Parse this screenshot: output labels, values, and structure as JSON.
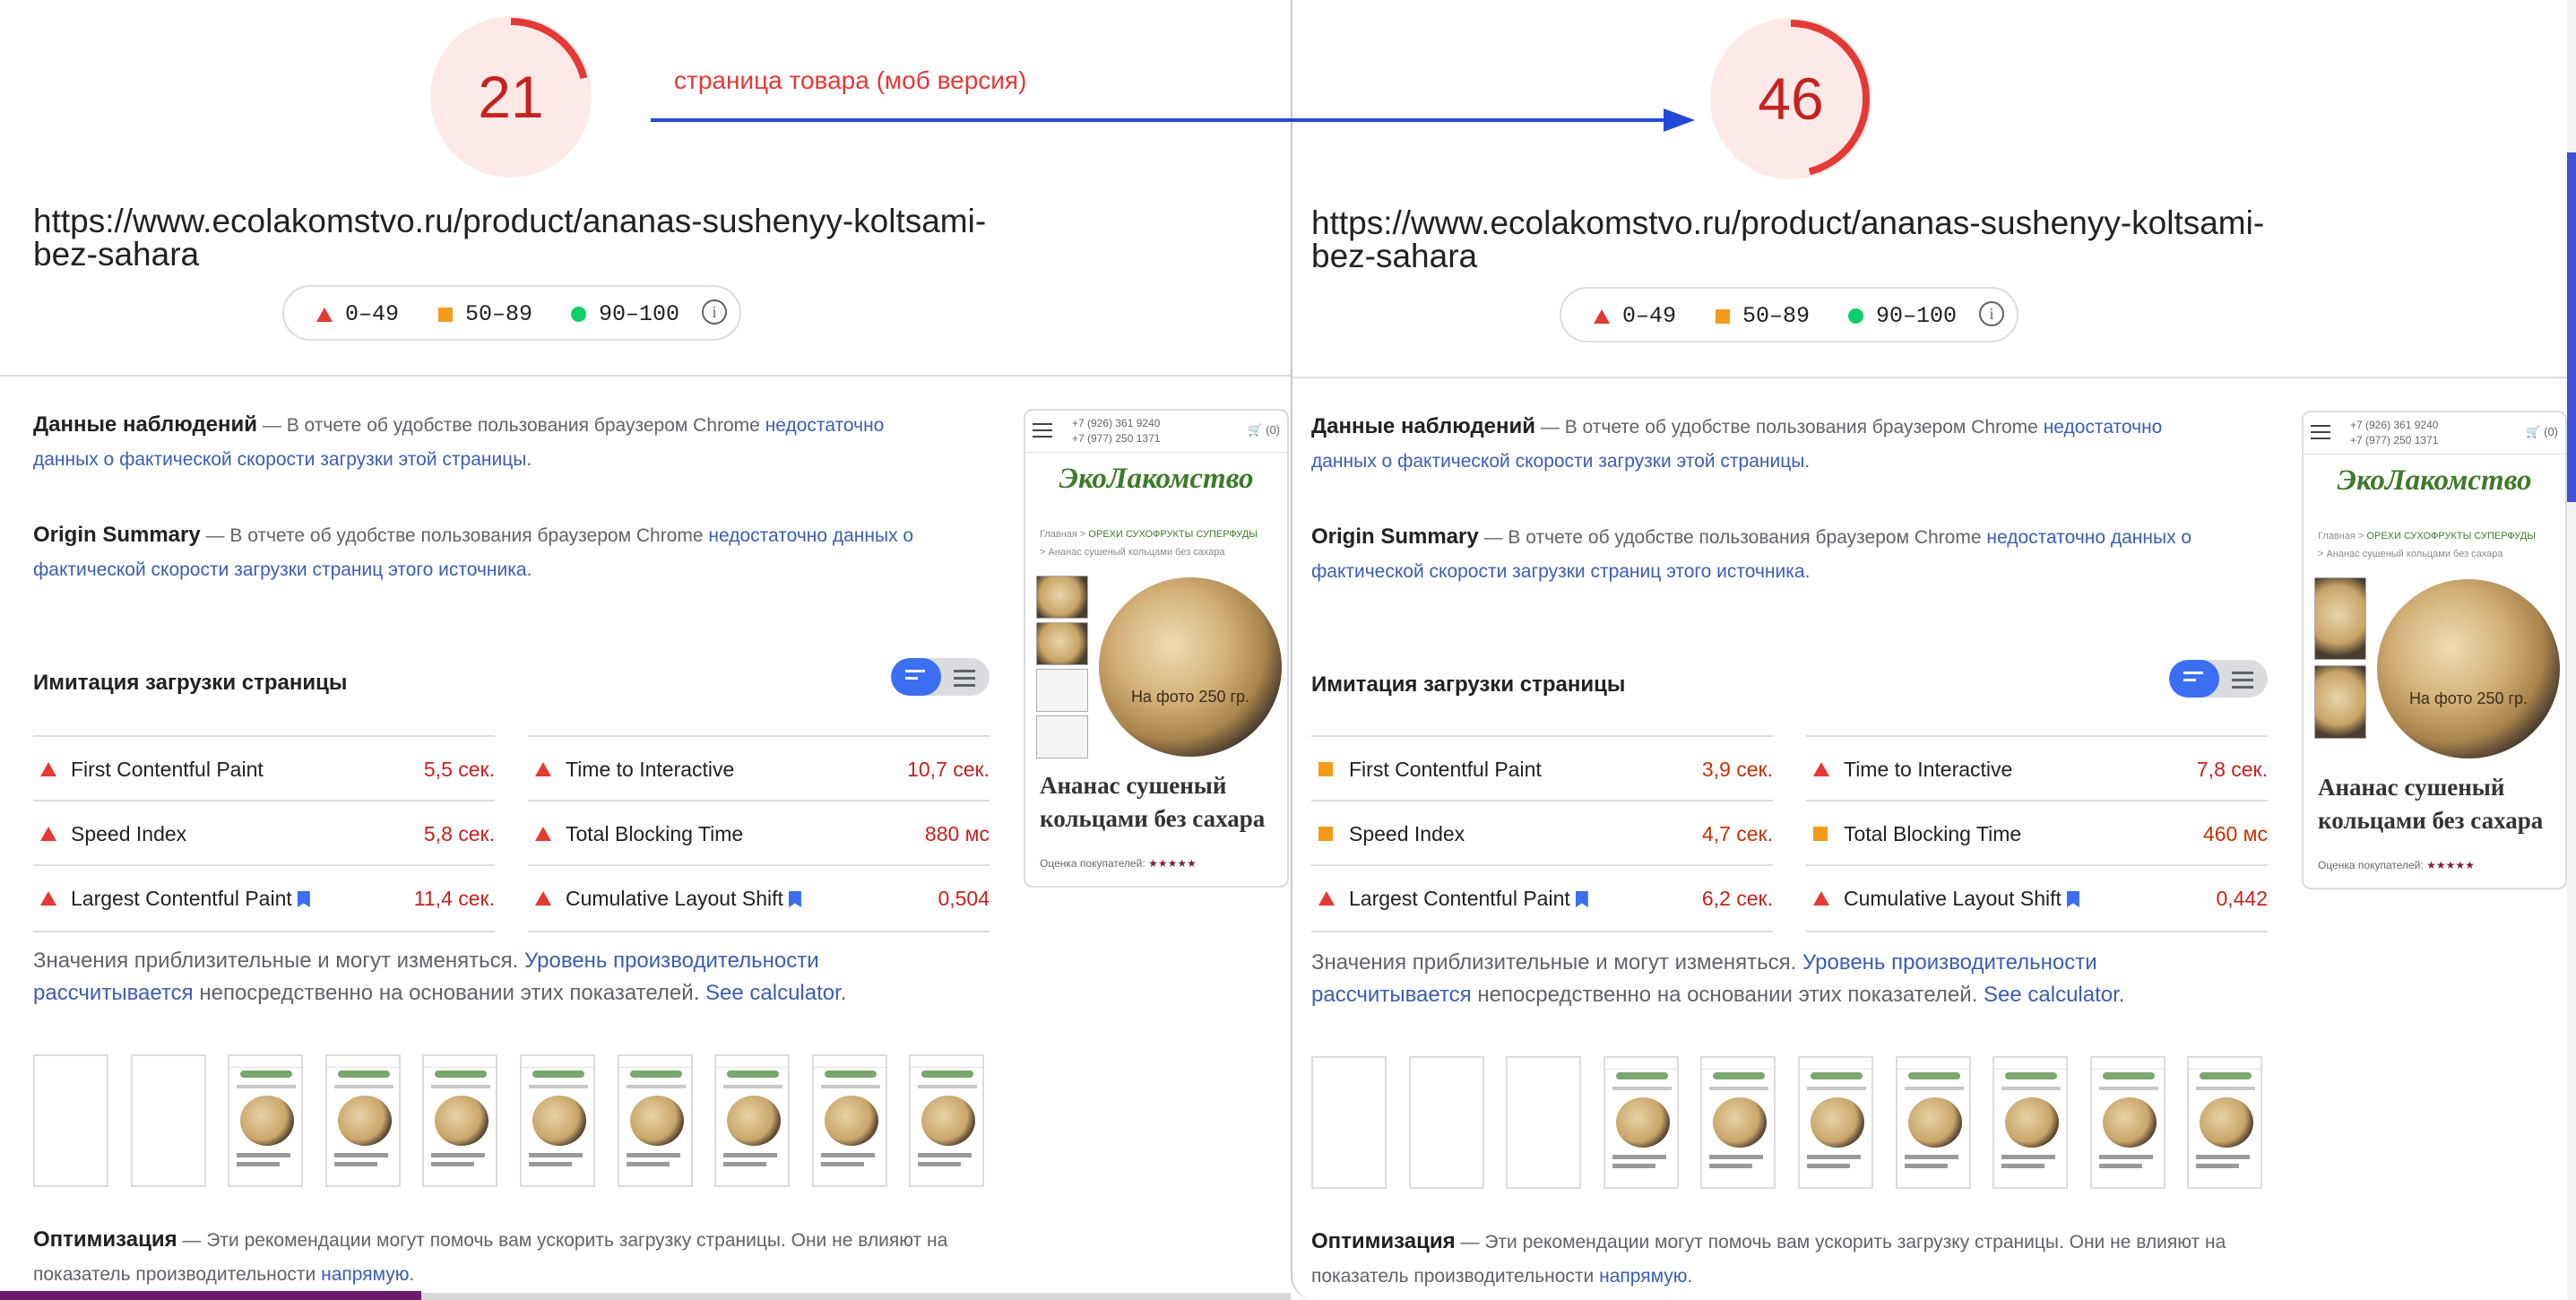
{
  "annotation": "страница товара (моб версия)",
  "colors": {
    "fail": "#e53935",
    "average": "#f49b1a",
    "pass": "#0cce6b",
    "link": "#3c5db1",
    "arrow": "#2448d9"
  },
  "left": {
    "score": "21",
    "score_fraction": 0.21,
    "url_line1": "https://www.ecolakomstvo.ru/product/ananas-sushenyy-koltsami-",
    "url_line2": "bez-sahara",
    "legend": {
      "fail": "0–49",
      "average": "50–89",
      "pass": "90–100"
    },
    "field_data": {
      "title": "Данные наблюдений",
      "dash": " — В отчете об удобстве пользования браузером Chrome ",
      "link": "недостаточно данных о фактической скорости загрузки этой страницы",
      "end": "."
    },
    "origin": {
      "title": "Origin Summary",
      "dash": " — В отчете об удобстве пользования браузером Chrome ",
      "link": "недостаточно данных о фактической скорости загрузки страниц этого источника",
      "end": "."
    },
    "lab_title": "Имитация загрузки страницы",
    "metrics": [
      {
        "name": "First Contentful Paint",
        "value": "5,5 сек.",
        "status": "fail",
        "bookmark": false
      },
      {
        "name": "Time to Interactive",
        "value": "10,7 сек.",
        "status": "fail",
        "bookmark": false
      },
      {
        "name": "Speed Index",
        "value": "5,8 сек.",
        "status": "fail",
        "bookmark": false
      },
      {
        "name": "Total Blocking Time",
        "value": "880 мс",
        "status": "fail",
        "bookmark": false
      },
      {
        "name": "Largest Contentful Paint",
        "value": "11,4 сек.",
        "status": "fail",
        "bookmark": true
      },
      {
        "name": "Cumulative Layout Shift",
        "value": "0,504",
        "status": "fail",
        "bookmark": true
      }
    ],
    "note": {
      "text1": "Значения приблизительные и могут изменяться. ",
      "link1": "Уровень производительности рассчитывается",
      "text2": " непосредственно на основании этих показателей. ",
      "link2": "See calculator",
      "end": "."
    },
    "filmstrip_blank": 2,
    "opt": {
      "title": "Оптимизация",
      "text": " — Эти рекомендации могут помочь вам ускорить загрузку страницы. Они не влияют на показатель производительности ",
      "link": "напрямую",
      "end": "."
    }
  },
  "right": {
    "score": "46",
    "score_fraction": 0.46,
    "url_line1": "https://www.ecolakomstvo.ru/product/ananas-sushenyy-koltsami-",
    "url_line2": "bez-sahara",
    "legend": {
      "fail": "0–49",
      "average": "50–89",
      "pass": "90–100"
    },
    "field_data": {
      "title": "Данные наблюдений",
      "dash": " — В отчете об удобстве пользования браузером Chrome ",
      "link": "недостаточно данных о фактической скорости загрузки этой страницы",
      "end": "."
    },
    "origin": {
      "title": "Origin Summary",
      "dash": " — В отчете об удобстве пользования браузером Chrome ",
      "link": "недостаточно данных о фактической скорости загрузки страниц этого источника",
      "end": "."
    },
    "lab_title": "Имитация загрузки страницы",
    "metrics": [
      {
        "name": "First Contentful Paint",
        "value": "3,9 сек.",
        "status": "average",
        "bookmark": false
      },
      {
        "name": "Time to Interactive",
        "value": "7,8 сек.",
        "status": "fail",
        "bookmark": false
      },
      {
        "name": "Speed Index",
        "value": "4,7 сек.",
        "status": "average",
        "bookmark": false
      },
      {
        "name": "Total Blocking Time",
        "value": "460 мс",
        "status": "average",
        "bookmark": false
      },
      {
        "name": "Largest Contentful Paint",
        "value": "6,2 сек.",
        "status": "fail",
        "bookmark": true
      },
      {
        "name": "Cumulative Layout Shift",
        "value": "0,442",
        "status": "fail",
        "bookmark": true
      }
    ],
    "note": {
      "text1": "Значения приблизительные и могут изменяться. ",
      "link1": "Уровень производительности рассчитывается",
      "text2": " непосредственно на основании этих показателей. ",
      "link2": "See calculator",
      "end": "."
    },
    "filmstrip_blank": 3,
    "opt": {
      "title": "Оптимизация",
      "text": " — Эти рекомендации могут помочь вам ускорить загрузку страницы. Они не влияют на показатель производительности ",
      "link": "напрямую",
      "end": "."
    }
  },
  "phone": {
    "phone1": "+7 (926) 361 9240",
    "phone2": "+7 (977) 250 1371",
    "cart": "(0)",
    "brand": "ЭкоЛакомство",
    "crumb_home": "Главная",
    "crumb_sep": " > ",
    "crumb_cat": "ОРЕХИ СУХОФРУКТЫ СУПЕРФУДЫ",
    "crumb_item": "Ананас сушеный кольцами без сахара",
    "image_label": "На фото 250 гр.",
    "title": "Ананас сушеный кольцами без сахара",
    "rating_label": "Оценка покупателей:",
    "stars": "★★★★★"
  }
}
